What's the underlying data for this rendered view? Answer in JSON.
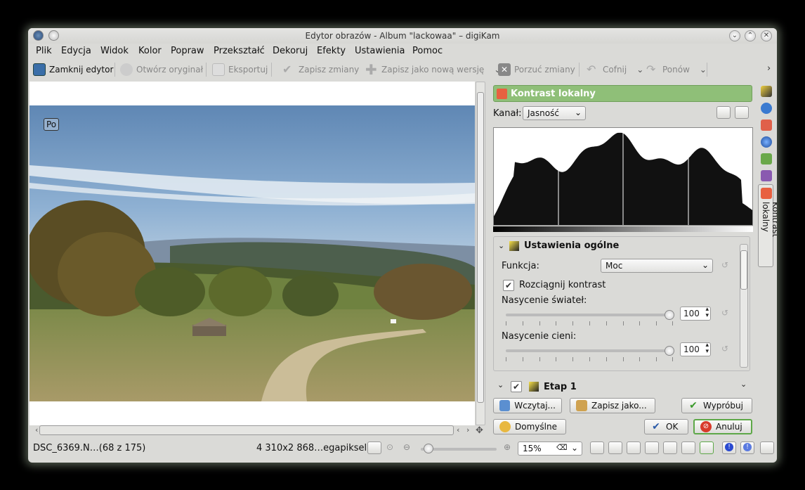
{
  "window": {
    "title": "Edytor obrazów - Album \"lackowaa\" – digiKam"
  },
  "menu": [
    "Plik",
    "Edycja",
    "Widok",
    "Kolor",
    "Popraw",
    "Przekształć",
    "Dekoruj",
    "Efekty",
    "Ustawienia",
    "Pomoc"
  ],
  "toolbar": {
    "close_editor": "Zamknij edytor",
    "open_original": "Otwórz oryginał",
    "export": "Eksportuj",
    "save_changes": "Zapisz zmiany",
    "save_new_version": "Zapisz jako nową wersję",
    "discard_changes": "Porzuć zmiany",
    "undo": "Cofnij",
    "redo": "Ponów"
  },
  "canvas": {
    "overlay_badge": "Po"
  },
  "tool": {
    "title": "Kontrast lokalny",
    "channel_label": "Kanał:",
    "channel_value": "Jasność",
    "section_general": "Ustawienia ogólne",
    "function_label": "Funkcja:",
    "function_value": "Moc",
    "stretch_contrast": "Rozciągnij kontrast",
    "stretch_checked": true,
    "highlights_label": "Nasycenie świateł:",
    "highlights_value": "100",
    "shadows_label": "Nasycenie cieni:",
    "shadows_value": "100",
    "stage1": "Etap 1",
    "side_tab": "Kontrast lokalny"
  },
  "buttons": {
    "load": "Wczytaj...",
    "save_as": "Zapisz jako...",
    "try": "Wypróbuj",
    "defaults": "Domyślne",
    "ok": "OK",
    "cancel": "Anuluj"
  },
  "status": {
    "filename": "DSC_6369.N…(68 z 175)",
    "dimensions": "4 310x2 868…egapikseli)",
    "zoom": "15%"
  },
  "colors": {
    "accent_green": "#8fbf78",
    "window_bg": "#dadad7"
  }
}
